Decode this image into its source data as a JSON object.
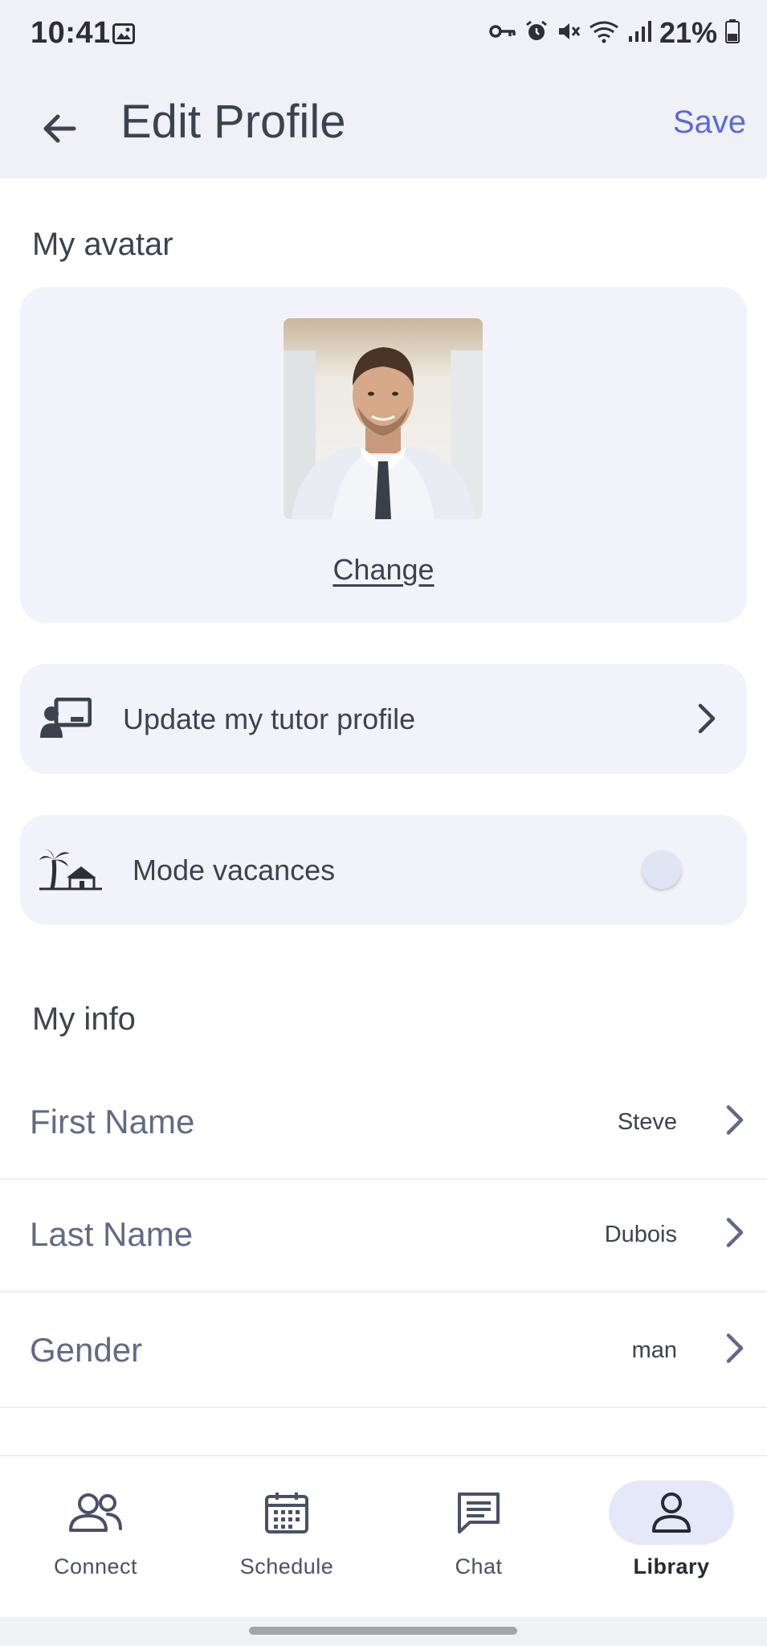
{
  "status_bar": {
    "time": "10:41",
    "battery": "21%",
    "icons": [
      "image-icon",
      "key-icon",
      "alarm-icon",
      "mute-icon",
      "wifi-icon",
      "signal-icon",
      "battery-icon"
    ]
  },
  "header": {
    "title": "Edit Profile",
    "save_label": "Save",
    "back_icon": "arrow-left-icon"
  },
  "avatar_section": {
    "title": "My avatar",
    "change_label": "Change"
  },
  "tutor_profile": {
    "label": "Update my tutor profile",
    "icon": "teacher-board-icon"
  },
  "vacation_mode": {
    "label": "Mode vacances",
    "icon": "palm-house-icon",
    "enabled": false
  },
  "info_section": {
    "title": "My info",
    "rows": [
      {
        "label": "First Name",
        "value": "Steve"
      },
      {
        "label": "Last Name",
        "value": "Dubois"
      },
      {
        "label": "Gender",
        "value": "man"
      }
    ]
  },
  "bottom_nav": {
    "items": [
      {
        "label": "Connect",
        "icon": "people-icon",
        "active": false
      },
      {
        "label": "Schedule",
        "icon": "calendar-icon",
        "active": false
      },
      {
        "label": "Chat",
        "icon": "chat-icon",
        "active": false
      },
      {
        "label": "Library",
        "icon": "person-icon",
        "active": true
      }
    ]
  },
  "colors": {
    "accent": "#5b6ad8",
    "header_bg": "#f0f1f7",
    "card_bg": "#f2f3fa",
    "active_nav_bg": "#e5e8f9"
  }
}
